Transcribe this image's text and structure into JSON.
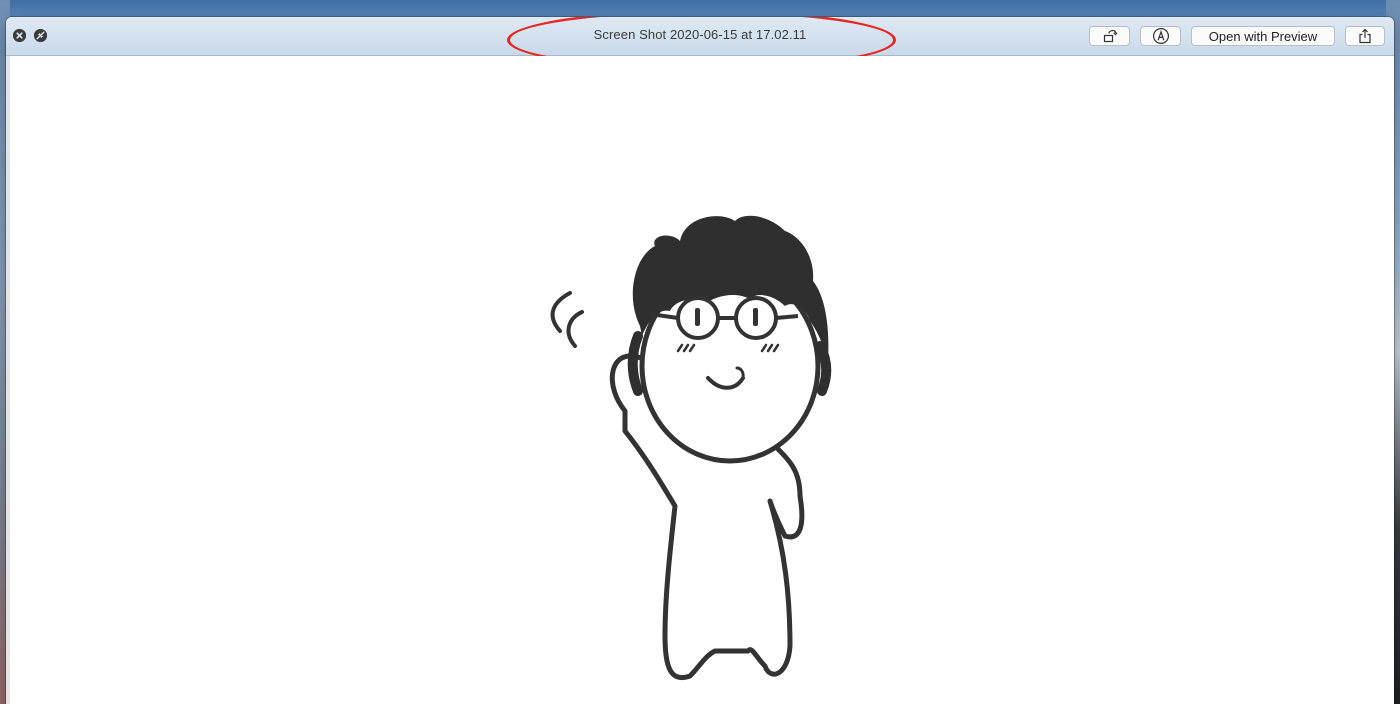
{
  "window": {
    "title": "Screen Shot 2020-06-15 at 17.02.11"
  },
  "toolbar": {
    "open_with_preview_label": "Open with Preview",
    "rotate_icon": "rotate-icon",
    "markup_icon": "markup-pen-icon",
    "share_icon": "share-icon"
  },
  "annotation": {
    "color": "#e8261f"
  },
  "image": {
    "subject": "cartoon waving person with glasses"
  }
}
